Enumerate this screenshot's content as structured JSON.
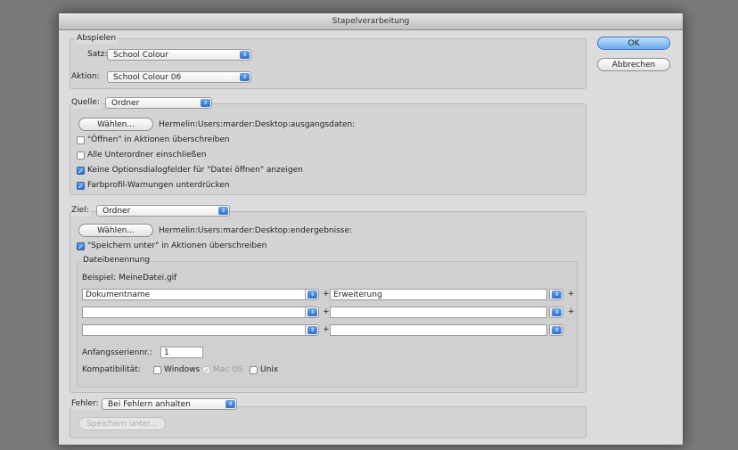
{
  "window": {
    "title": "Stapelverarbeitung"
  },
  "buttons": {
    "ok": "OK",
    "cancel": "Abbrechen"
  },
  "abspielen": {
    "legend": "Abspielen",
    "satz_label": "Satz:",
    "satz_value": "School Colour",
    "aktion_label": "Aktion:",
    "aktion_value": "School Colour 06"
  },
  "quelle": {
    "label": "Quelle:",
    "value": "Ordner",
    "choose_button": "Wählen...",
    "path": "Hermelin:Users:marder:Desktop:ausgangsdaten:",
    "checkboxes": [
      {
        "label": "\"Öffnen\" in Aktionen überschreiben",
        "checked": false
      },
      {
        "label": "Alle Unterordner einschließen",
        "checked": false
      },
      {
        "label": "Keine Optionsdialogfelder für \"Datei öffnen\" anzeigen",
        "checked": true
      },
      {
        "label": "Farbprofil-Warnungen unterdrücken",
        "checked": true
      }
    ]
  },
  "ziel": {
    "label": "Ziel:",
    "value": "Ordner",
    "choose_button": "Wählen...",
    "path": "Hermelin:Users:marder:Desktop:endergebnisse:",
    "override_label": "\"Speichern unter\" in Aktionen überschreiben",
    "override_checked": true,
    "naming": {
      "legend": "Dateibenennung",
      "example": "Beispiel: MeineDatei.gif",
      "rows": [
        {
          "left": "Dokumentname",
          "right": "Erweiterung",
          "plus_left": "+",
          "plus_right": "+"
        },
        {
          "left": "",
          "right": "",
          "plus_left": "+",
          "plus_right": "+"
        },
        {
          "left": "",
          "right": "",
          "plus_left": "+",
          "plus_right": ""
        }
      ],
      "serial_label": "Anfangsseriennr.:",
      "serial_value": "1",
      "compat_label": "Kompatibilität:",
      "compat": [
        {
          "label": "Windows",
          "checked": false,
          "enabled": true
        },
        {
          "label": "Mac OS",
          "checked": true,
          "enabled": false
        },
        {
          "label": "Unix",
          "checked": false,
          "enabled": true
        }
      ]
    }
  },
  "fehler": {
    "label": "Fehler:",
    "value": "Bei Fehlern anhalten",
    "save_button": "Speichern unter..."
  },
  "icons": {
    "popup_arrow": "⇕",
    "check": "✓"
  }
}
